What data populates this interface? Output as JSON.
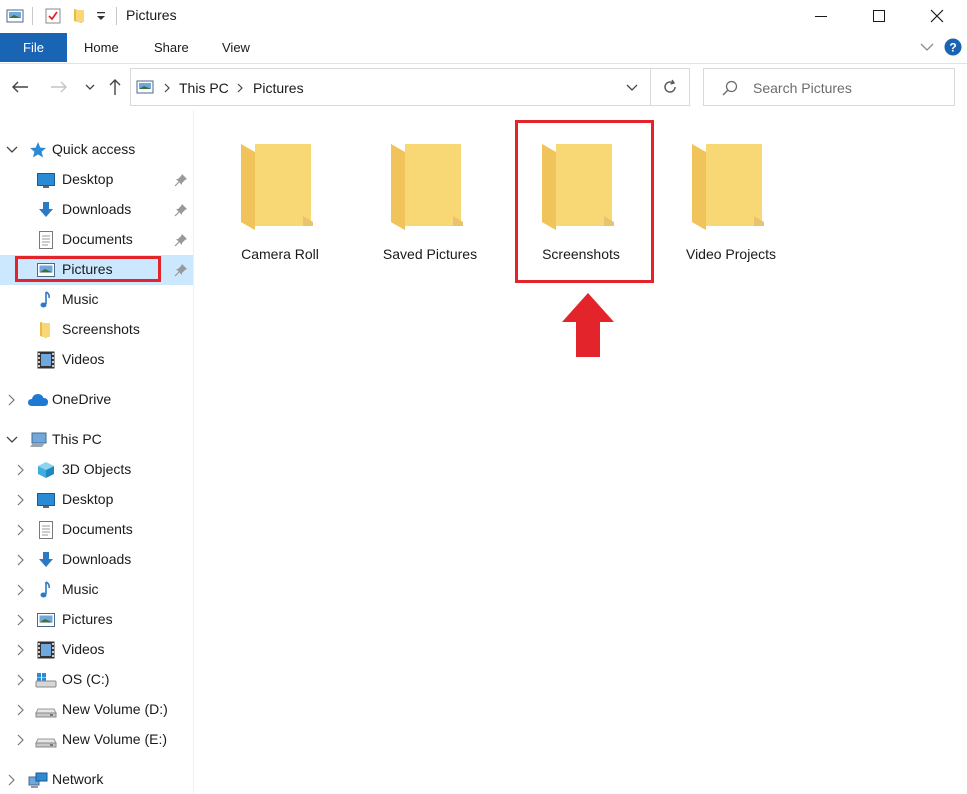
{
  "window": {
    "title": "Pictures"
  },
  "ribbon": {
    "file": "File",
    "tabs": [
      "Home",
      "Share",
      "View"
    ]
  },
  "address": {
    "crumbs": [
      "This PC",
      "Pictures"
    ]
  },
  "search": {
    "placeholder": "Search Pictures"
  },
  "navpane": {
    "quick_access": {
      "label": "Quick access",
      "items": [
        {
          "label": "Desktop",
          "icon": "desktop-icon",
          "pinned": true
        },
        {
          "label": "Downloads",
          "icon": "downloads-icon",
          "pinned": true
        },
        {
          "label": "Documents",
          "icon": "documents-icon",
          "pinned": true
        },
        {
          "label": "Pictures",
          "icon": "pictures-icon",
          "pinned": true,
          "selected": true
        },
        {
          "label": "Music",
          "icon": "music-icon",
          "pinned": false
        },
        {
          "label": "Screenshots",
          "icon": "folder-icon",
          "pinned": false
        },
        {
          "label": "Videos",
          "icon": "videos-icon",
          "pinned": false
        }
      ]
    },
    "onedrive": {
      "label": "OneDrive"
    },
    "this_pc": {
      "label": "This PC",
      "items": [
        {
          "label": "3D Objects",
          "icon": "3d-objects-icon"
        },
        {
          "label": "Desktop",
          "icon": "desktop-icon"
        },
        {
          "label": "Documents",
          "icon": "documents-icon"
        },
        {
          "label": "Downloads",
          "icon": "downloads-icon"
        },
        {
          "label": "Music",
          "icon": "music-icon"
        },
        {
          "label": "Pictures",
          "icon": "pictures-icon"
        },
        {
          "label": "Videos",
          "icon": "videos-icon"
        },
        {
          "label": "OS (C:)",
          "icon": "os-drive-icon"
        },
        {
          "label": "New Volume (D:)",
          "icon": "drive-icon"
        },
        {
          "label": "New Volume (E:)",
          "icon": "drive-icon"
        }
      ]
    },
    "network": {
      "label": "Network"
    }
  },
  "folders": [
    {
      "label": "Camera Roll"
    },
    {
      "label": "Saved Pictures"
    },
    {
      "label": "Screenshots",
      "highlighted": true
    },
    {
      "label": "Video Projects"
    }
  ],
  "colors": {
    "accent": "#1a64b4",
    "selected_bg": "#cce8ff",
    "highlight_red": "#e3242b",
    "folder_yellow": "#f8d775"
  }
}
